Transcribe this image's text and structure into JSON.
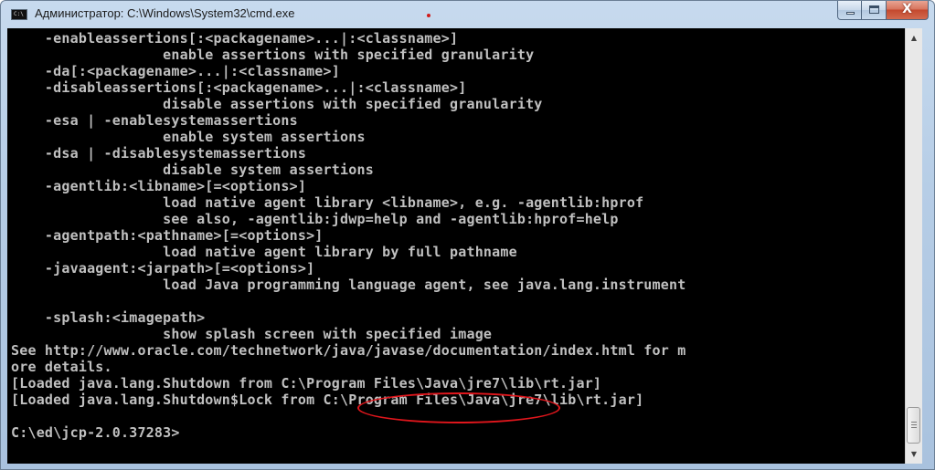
{
  "window": {
    "title": "Администратор: C:\\Windows\\System32\\cmd.exe",
    "icon": "cmd-icon",
    "icon_text": "C:\\",
    "buttons": {
      "minimize": "minimize-icon",
      "maximize": "maximize-icon",
      "close": "close-icon",
      "close_glyph": "X"
    }
  },
  "console": {
    "lines": [
      "    -enableassertions[:<packagename>...|:<classname>]",
      "                  enable assertions with specified granularity",
      "    -da[:<packagename>...|:<classname>]",
      "    -disableassertions[:<packagename>...|:<classname>]",
      "                  disable assertions with specified granularity",
      "    -esa | -enablesystemassertions",
      "                  enable system assertions",
      "    -dsa | -disablesystemassertions",
      "                  disable system assertions",
      "    -agentlib:<libname>[=<options>]",
      "                  load native agent library <libname>, e.g. -agentlib:hprof",
      "                  see also, -agentlib:jdwp=help and -agentlib:hprof=help",
      "    -agentpath:<pathname>[=<options>]",
      "                  load native agent library by full pathname",
      "    -javaagent:<jarpath>[=<options>]",
      "                  load Java programming language agent, see java.lang.instrument",
      "",
      "    -splash:<imagepath>",
      "                  show splash screen with specified image",
      "See http://www.oracle.com/technetwork/java/javase/documentation/index.html for m",
      "ore details.",
      "[Loaded java.lang.Shutdown from C:\\Program Files\\Java\\jre7\\lib\\rt.jar]",
      "[Loaded java.lang.Shutdown$Lock from C:\\Program Files\\Java\\jre7\\lib\\rt.jar]",
      "",
      "C:\\ed\\jcp-2.0.37283>"
    ],
    "text_color": "#c0c0c0",
    "background": "#000000",
    "annotation_color": "#e0161c"
  },
  "scrollbar": {
    "up_icon": "scroll-up-arrow-icon",
    "up_glyph": "▲",
    "down_icon": "scroll-down-arrow-icon",
    "down_glyph": "▼"
  }
}
